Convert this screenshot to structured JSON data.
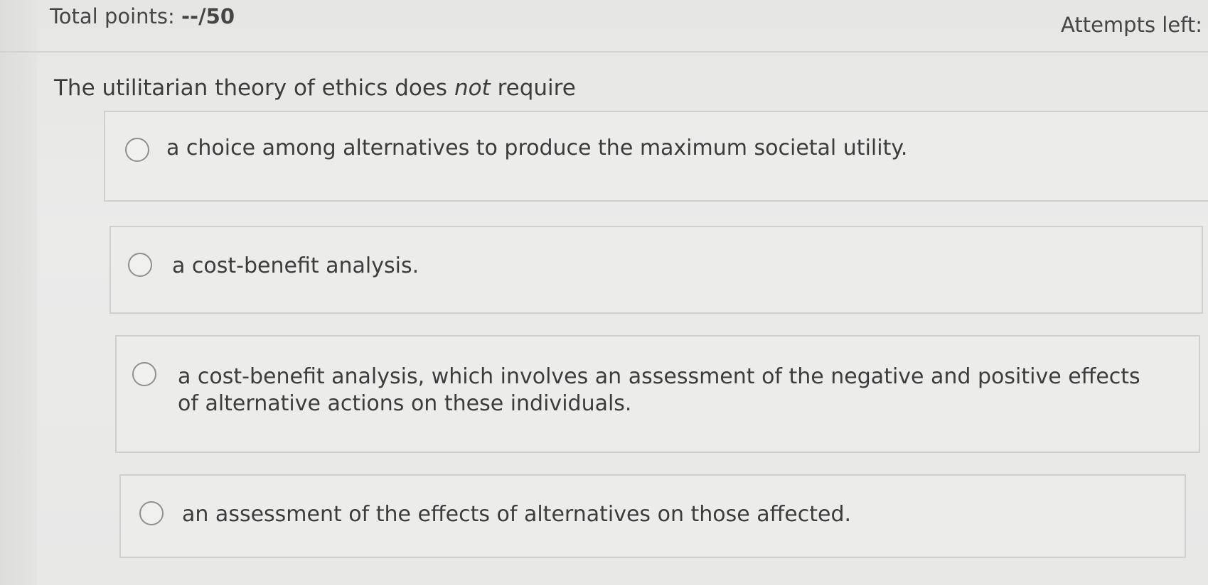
{
  "header": {
    "total_points_label": "Total points: ",
    "total_points_value": "--/50",
    "attempts_label": "Attempts left:"
  },
  "question": {
    "text_before": "The utilitarian theory of ethics does ",
    "emphasis": "not",
    "text_after": " require"
  },
  "options": [
    {
      "label": "a choice among alternatives to produce the maximum societal utility."
    },
    {
      "label": "a cost-benefit analysis."
    },
    {
      "label": "a cost-benefit analysis, which involves an assessment of the negative and positive effects of alternative actions on these individuals."
    },
    {
      "label": "an assessment of the effects of alternatives on those affected."
    }
  ]
}
